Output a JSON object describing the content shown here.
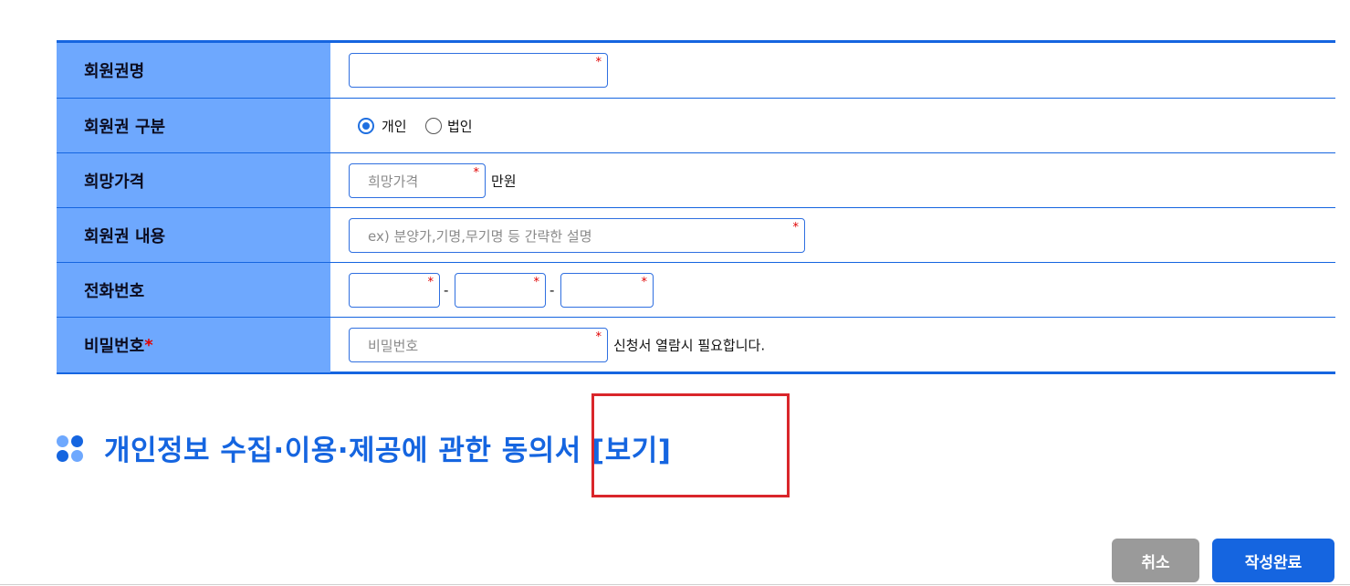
{
  "form": {
    "rows": [
      {
        "label": "회원권명"
      },
      {
        "label": "회원권 구분"
      },
      {
        "label": "희망가격"
      },
      {
        "label": "회원권 내용"
      },
      {
        "label": "전화번호"
      },
      {
        "label": "비밀번호",
        "required_mark": "*"
      }
    ],
    "membership_name": {
      "value": "",
      "required_mark": "*"
    },
    "membership_type": {
      "options": [
        "개인",
        "법인"
      ],
      "selected": "개인"
    },
    "desired_price": {
      "placeholder": "희망가격",
      "required_mark": "*",
      "unit": "만원"
    },
    "description": {
      "placeholder": "ex) 분양가,기명,무기명 등 간략한 설명",
      "required_mark": "*"
    },
    "phone": {
      "separator": "-",
      "required_mark": "*"
    },
    "password": {
      "placeholder": "비밀번호",
      "required_mark": "*",
      "note": "신청서 열람시 필요합니다."
    }
  },
  "consent": {
    "title": "개인정보 수집·이용·제공에 관한 동의서 [보기]"
  },
  "buttons": {
    "cancel": "취소",
    "submit": "작성완료"
  },
  "colors": {
    "accent": "#1565e0",
    "label_bg": "#6ea8fe",
    "required": "#e00000",
    "highlight": "#d9262b",
    "cancel_bg": "#9a9a9a"
  }
}
